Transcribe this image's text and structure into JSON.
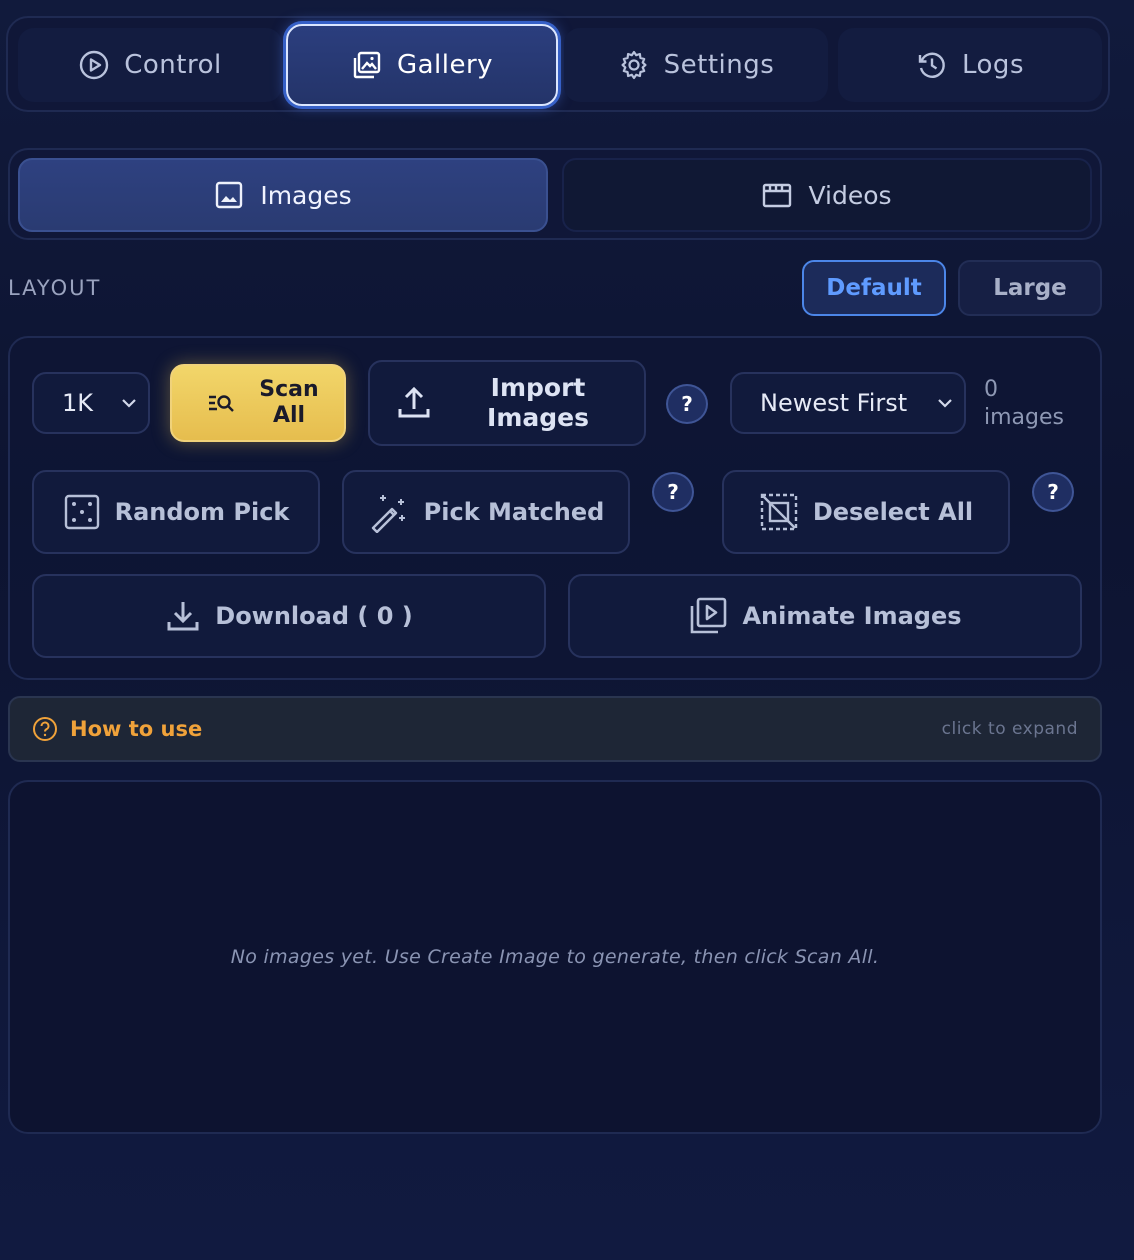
{
  "nav": {
    "tabs": [
      {
        "label": "Control",
        "icon": "play-circle-icon"
      },
      {
        "label": "Gallery",
        "icon": "gallery-icon",
        "active": true
      },
      {
        "label": "Settings",
        "icon": "gear-icon"
      },
      {
        "label": "Logs",
        "icon": "history-icon"
      }
    ]
  },
  "media_tabs": [
    {
      "label": "Images",
      "icon": "image-icon",
      "active": true
    },
    {
      "label": "Videos",
      "icon": "clapperboard-icon"
    }
  ],
  "layout": {
    "label": "LAYOUT",
    "options": [
      {
        "label": "Default",
        "selected": true
      },
      {
        "label": "Large"
      }
    ]
  },
  "controls": {
    "resolution_value": "1K",
    "scan_label_line1": "Scan",
    "scan_label_line2": "All",
    "import_label_line1": "Import",
    "import_label_line2": "Images",
    "help_label": "?",
    "sort_value": "Newest First",
    "count_number": "0",
    "count_unit": "images",
    "random_pick": "Random Pick",
    "pick_matched": "Pick Matched",
    "deselect_all": "Deselect All",
    "download": "Download ( 0 )",
    "animate": "Animate Images"
  },
  "howto": {
    "title": "How to use",
    "hint": "click to expand"
  },
  "gallery": {
    "empty_message": "No images yet. Use Create Image to generate, then click Scan All."
  },
  "colors": {
    "accent_gold": "#e9c55a",
    "accent_blue": "#4c86e8",
    "howto_orange": "#f0a23a"
  }
}
